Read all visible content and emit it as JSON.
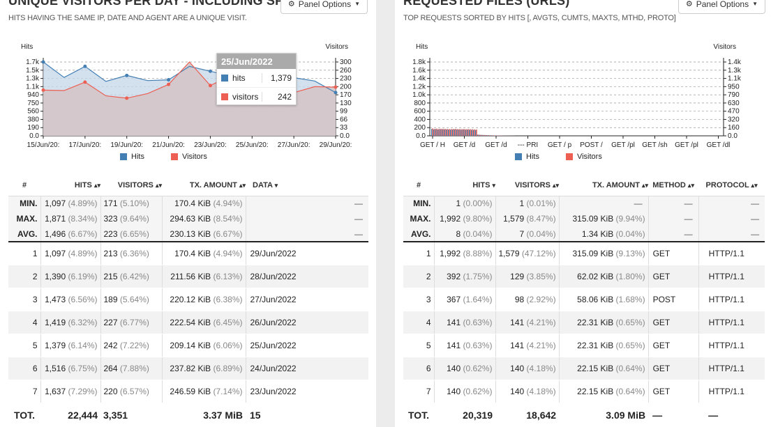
{
  "colors": {
    "hits": "#447fb3",
    "visitors": "#ec5f52",
    "hits_fill": "#c4d7ea",
    "overlap_fill": "#d4c6c9",
    "tooltip_head": "#aaaaaa"
  },
  "left": {
    "title": "UNIQUE VISITORS PER DAY - INCLUDING SPIDERS",
    "subtitle": "HITS HAVING THE SAME IP, DATE AND AGENT ARE A UNIQUE VISIT.",
    "options_label": "Panel Options",
    "options_icon": "gear-icon",
    "legend": [
      "Hits",
      "Visitors"
    ],
    "tooltip": {
      "date": "25/Jun/2022",
      "rows": [
        {
          "name": "hits",
          "value": "1,379"
        },
        {
          "name": "visitors",
          "value": "242"
        }
      ]
    },
    "table": {
      "headers": [
        "#",
        "HITS",
        "VISITORS",
        "TX. AMOUNT",
        "DATA"
      ],
      "sort_icons": [
        "",
        "▴▾",
        "▴▾",
        "▴▾",
        "▾"
      ],
      "stats": [
        {
          "label": "MIN.",
          "hits": "1,097",
          "hits_pct": "(4.89%)",
          "visitors": "171",
          "visitors_pct": "(5.10%)",
          "tx": "170.4 KiB",
          "tx_pct": "(4.94%)",
          "data": "—"
        },
        {
          "label": "MAX.",
          "hits": "1,871",
          "hits_pct": "(8.34%)",
          "visitors": "323",
          "visitors_pct": "(9.64%)",
          "tx": "294.63 KiB",
          "tx_pct": "(8.54%)",
          "data": "—"
        },
        {
          "label": "AVG.",
          "hits": "1,496",
          "hits_pct": "(6.67%)",
          "visitors": "223",
          "visitors_pct": "(6.65%)",
          "tx": "230.13 KiB",
          "tx_pct": "(6.67%)",
          "data": "—"
        }
      ],
      "rows": [
        {
          "idx": "1",
          "hits": "1,097",
          "hits_pct": "(4.89%)",
          "visitors": "213",
          "visitors_pct": "(6.36%)",
          "tx": "170.4 KiB",
          "tx_pct": "(4.94%)",
          "data": "29/Jun/2022"
        },
        {
          "idx": "2",
          "hits": "1,390",
          "hits_pct": "(6.19%)",
          "visitors": "215",
          "visitors_pct": "(6.42%)",
          "tx": "211.56 KiB",
          "tx_pct": "(6.13%)",
          "data": "28/Jun/2022"
        },
        {
          "idx": "3",
          "hits": "1,473",
          "hits_pct": "(6.56%)",
          "visitors": "189",
          "visitors_pct": "(5.64%)",
          "tx": "220.12 KiB",
          "tx_pct": "(6.38%)",
          "data": "27/Jun/2022"
        },
        {
          "idx": "4",
          "hits": "1,419",
          "hits_pct": "(6.32%)",
          "visitors": "227",
          "visitors_pct": "(6.77%)",
          "tx": "222.54 KiB",
          "tx_pct": "(6.45%)",
          "data": "26/Jun/2022"
        },
        {
          "idx": "5",
          "hits": "1,379",
          "hits_pct": "(6.14%)",
          "visitors": "242",
          "visitors_pct": "(7.22%)",
          "tx": "209.14 KiB",
          "tx_pct": "(6.06%)",
          "data": "25/Jun/2022"
        },
        {
          "idx": "6",
          "hits": "1,516",
          "hits_pct": "(6.75%)",
          "visitors": "264",
          "visitors_pct": "(7.88%)",
          "tx": "237.82 KiB",
          "tx_pct": "(6.89%)",
          "data": "24/Jun/2022"
        },
        {
          "idx": "7",
          "hits": "1,637",
          "hits_pct": "(7.29%)",
          "visitors": "220",
          "visitors_pct": "(6.57%)",
          "tx": "246.59 KiB",
          "tx_pct": "(7.14%)",
          "data": "23/Jun/2022"
        }
      ],
      "total": {
        "label": "TOT.",
        "hits": "22,444",
        "visitors": "3,351",
        "tx": "3.37 MiB",
        "data": "15"
      }
    }
  },
  "right": {
    "title": "REQUESTED FILES (URLS)",
    "subtitle": "TOP REQUESTS SORTED BY HITS [, AVGTS, CUMTS, MAXTS, MTHD, PROTO]",
    "options_label": "Panel Options",
    "options_icon": "gear-icon",
    "legend": [
      "Hits",
      "Visitors"
    ],
    "table": {
      "headers": [
        "#",
        "HITS",
        "VISITORS",
        "TX. AMOUNT",
        "METHOD",
        "PROTOCOL"
      ],
      "sort_icons": [
        "",
        "▾",
        "▴▾",
        "▴▾",
        "▴▾",
        "▴▾"
      ],
      "stats": [
        {
          "label": "MIN.",
          "hits": "1",
          "hits_pct": "(0.00%)",
          "visitors": "1",
          "visitors_pct": "(0.01%)",
          "tx": "—",
          "tx_pct": "",
          "method": "—",
          "protocol": "—"
        },
        {
          "label": "MAX.",
          "hits": "1,992",
          "hits_pct": "(9.80%)",
          "visitors": "1,579",
          "visitors_pct": "(8.47%)",
          "tx": "315.09 KiB",
          "tx_pct": "(9.94%)",
          "method": "—",
          "protocol": "—"
        },
        {
          "label": "AVG.",
          "hits": "8",
          "hits_pct": "(0.04%)",
          "visitors": "7",
          "visitors_pct": "(0.04%)",
          "tx": "1.34 KiB",
          "tx_pct": "(0.04%)",
          "method": "—",
          "protocol": "—"
        }
      ],
      "rows": [
        {
          "idx": "1",
          "hits": "1,992",
          "hits_pct": "(8.88%)",
          "visitors": "1,579",
          "visitors_pct": "(47.12%)",
          "tx": "315.09 KiB",
          "tx_pct": "(9.13%)",
          "method": "GET",
          "protocol": "HTTP/1.1"
        },
        {
          "idx": "2",
          "hits": "392",
          "hits_pct": "(1.75%)",
          "visitors": "129",
          "visitors_pct": "(3.85%)",
          "tx": "62.02 KiB",
          "tx_pct": "(1.80%)",
          "method": "GET",
          "protocol": "HTTP/1.1"
        },
        {
          "idx": "3",
          "hits": "367",
          "hits_pct": "(1.64%)",
          "visitors": "98",
          "visitors_pct": "(2.92%)",
          "tx": "58.06 KiB",
          "tx_pct": "(1.68%)",
          "method": "POST",
          "protocol": "HTTP/1.1"
        },
        {
          "idx": "4",
          "hits": "141",
          "hits_pct": "(0.63%)",
          "visitors": "141",
          "visitors_pct": "(4.21%)",
          "tx": "22.31 KiB",
          "tx_pct": "(0.65%)",
          "method": "GET",
          "protocol": "HTTP/1.1"
        },
        {
          "idx": "5",
          "hits": "141",
          "hits_pct": "(0.63%)",
          "visitors": "141",
          "visitors_pct": "(4.21%)",
          "tx": "22.31 KiB",
          "tx_pct": "(0.65%)",
          "method": "GET",
          "protocol": "HTTP/1.1"
        },
        {
          "idx": "6",
          "hits": "140",
          "hits_pct": "(0.62%)",
          "visitors": "140",
          "visitors_pct": "(4.18%)",
          "tx": "22.15 KiB",
          "tx_pct": "(0.64%)",
          "method": "GET",
          "protocol": "HTTP/1.1"
        },
        {
          "idx": "7",
          "hits": "140",
          "hits_pct": "(0.62%)",
          "visitors": "140",
          "visitors_pct": "(4.18%)",
          "tx": "22.15 KiB",
          "tx_pct": "(0.64%)",
          "method": "GET",
          "protocol": "HTTP/1.1"
        }
      ],
      "total": {
        "label": "TOT.",
        "hits": "20,319",
        "visitors": "18,642",
        "tx": "3.09 MiB",
        "method": "—",
        "protocol": "—"
      }
    }
  },
  "chart_data": [
    {
      "type": "area",
      "ylabel": "Hits",
      "y2label": "Visitors",
      "x": [
        "15/Jun/2022",
        "16/Jun/2022",
        "17/Jun/2022",
        "18/Jun/2022",
        "19/Jun/2022",
        "20/Jun/2022",
        "21/Jun/2022",
        "22/Jun/2022",
        "23/Jun/2022",
        "24/Jun/2022",
        "25/Jun/2022",
        "26/Jun/2022",
        "27/Jun/2022",
        "28/Jun/2022",
        "29/Jun/2022"
      ],
      "x_tick_labels": [
        "15/Jun/20:",
        "17/Jun/20:",
        "19/Jun/20:",
        "21/Jun/20:",
        "23/Jun/20:",
        "25/Jun/20:",
        "27/Jun/20:",
        "29/Jun/20:"
      ],
      "x_tick_indices": [
        0,
        2,
        4,
        6,
        8,
        10,
        12,
        14
      ],
      "y_ticks": [
        "0.0",
        "190",
        "380",
        "560",
        "750",
        "940",
        "1.1k",
        "1.3k",
        "1.5k",
        "1.7k"
      ],
      "y2_ticks": [
        "0.0",
        "33",
        "66",
        "99",
        "130",
        "170",
        "200",
        "230",
        "260",
        "300"
      ],
      "ylim": [
        0,
        1871
      ],
      "y2lim": [
        0,
        323
      ],
      "series": [
        {
          "name": "Hits",
          "axis": "left",
          "values": [
            1871,
            1480,
            1760,
            1380,
            1530,
            1400,
            1420,
            1760,
            1637,
            1516,
            1379,
            1419,
            1473,
            1390,
            1097
          ]
        },
        {
          "name": "Visitors",
          "axis": "right",
          "values": [
            200,
            198,
            235,
            175,
            165,
            185,
            225,
            323,
            220,
            264,
            242,
            227,
            189,
            215,
            213
          ]
        }
      ],
      "grid": true,
      "legend_position": "bottom"
    },
    {
      "type": "bar",
      "ylabel": "Hits",
      "y2label": "Visitors",
      "x_tick_labels": [
        "GET / H",
        "GET /d",
        "GET /d",
        "--- PRI",
        "GET / p",
        "POST /",
        "GET /pl",
        "GET /sh",
        "GET /pl",
        "GET /dl"
      ],
      "y_ticks": [
        "0.0",
        "200",
        "400",
        "600",
        "800",
        "1.0k",
        "1.2k",
        "1.4k",
        "1.6k",
        "1.8k"
      ],
      "y2_ticks": [
        "0.0",
        "160",
        "320",
        "470",
        "630",
        "790",
        "950",
        "1.1k",
        "1.3k",
        "1.4k"
      ],
      "ylim": [
        0,
        1992
      ],
      "y2lim": [
        0,
        1579
      ],
      "series": [
        {
          "name": "Hits",
          "axis": "left",
          "values": [
            185,
            175,
            180,
            170,
            178,
            176,
            174,
            172,
            170,
            168,
            172,
            175,
            170,
            168,
            166,
            170,
            165,
            168,
            166,
            163,
            160,
            158,
            30,
            25,
            22,
            20,
            18,
            16,
            14,
            12,
            10,
            9,
            8,
            7,
            6,
            5,
            5,
            4,
            3,
            3
          ]
        },
        {
          "name": "Visitors",
          "axis": "right",
          "values": [
            160,
            150,
            155,
            150,
            152,
            151,
            150,
            148,
            147,
            146,
            148,
            150,
            147,
            146,
            144,
            147,
            143,
            145,
            143,
            141,
            139,
            137,
            25,
            21,
            19,
            17,
            15,
            14,
            12,
            10,
            9,
            8,
            7,
            6,
            5,
            4,
            4,
            3,
            3,
            2
          ]
        }
      ],
      "grid": true,
      "legend_position": "bottom"
    }
  ]
}
